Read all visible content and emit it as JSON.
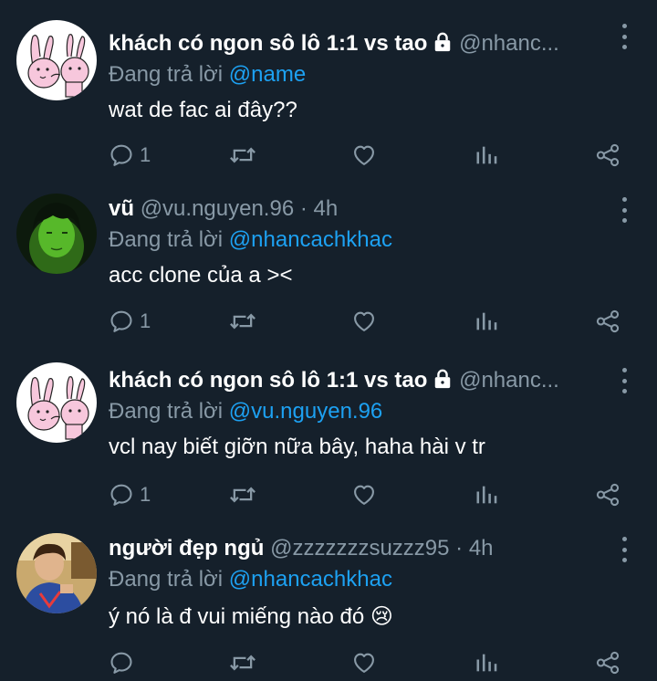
{
  "tweets": [
    {
      "name": "khách có ngon sô lô 1:1 vs tao",
      "locked": true,
      "handle": "@nhanc...",
      "meta": "",
      "reply_prefix": "Đang trả lời",
      "reply_to": "@name",
      "text": "wat de fac ai đây??",
      "reply_count": "1",
      "avatar": "bunny-sketch"
    },
    {
      "name": "vũ",
      "locked": false,
      "handle": "@vu.nguyen.96",
      "meta": "· 4h",
      "reply_prefix": "Đang trả lời",
      "reply_to": "@nhancachkhac",
      "text": "acc clone của a ><",
      "reply_count": "1",
      "avatar": "green-portrait"
    },
    {
      "name": "khách có ngon sô lô 1:1 vs tao",
      "locked": true,
      "handle": "@nhanc...",
      "meta": "",
      "reply_prefix": "Đang trả lời",
      "reply_to": "@vu.nguyen.96",
      "text": "vcl nay biết giỡn nữa bây, haha hài v tr",
      "reply_count": "1",
      "avatar": "bunny-sketch"
    },
    {
      "name": "người đẹp ngủ",
      "locked": false,
      "handle": "@zzzzzzzsuzzz95",
      "meta": "· 4h",
      "reply_prefix": "Đang trả lời",
      "reply_to": "@nhancachkhac",
      "text": "ý nó là đ vui miếng nào đó 😢",
      "reply_count": "",
      "avatar": "photo-portrait"
    }
  ],
  "icons": {
    "reply": "reply-icon",
    "retweet": "retweet-icon",
    "like": "heart-icon",
    "analytics": "analytics-icon",
    "share": "share-icon",
    "more": "more-icon",
    "lock": "lock-icon"
  },
  "colors": {
    "background": "#15202b",
    "secondary_text": "#8899a6",
    "link": "#1da1f2"
  }
}
